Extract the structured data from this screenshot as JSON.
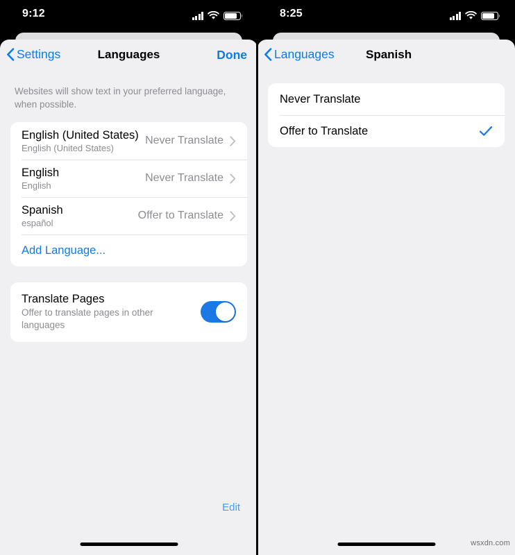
{
  "colors": {
    "accent_blue": "#0a7bf0",
    "toggle_blue": "#1a79e5",
    "check_blue": "#1f7be0",
    "sheet_bg": "#f0f0f3",
    "card_bg": "#ffffff",
    "secondary_text": "#8c8c91",
    "edit_blue": "#4a9bf5"
  },
  "left_panel": {
    "status": {
      "time": "9:12",
      "signal_icon": "cellular-signal-icon",
      "wifi_icon": "wifi-icon",
      "battery_icon": "battery-icon"
    },
    "nav": {
      "back_label": "Settings",
      "back_icon": "chevron-left-icon",
      "title": "Languages",
      "done_label": "Done"
    },
    "footnote": "Websites will show text in your preferred language, when possible.",
    "languages": [
      {
        "title": "English (United States)",
        "subtitle": "English (United States)",
        "value": "Never Translate",
        "disclosure_icon": "chevron-right-icon"
      },
      {
        "title": "English",
        "subtitle": "English",
        "value": "Never Translate",
        "disclosure_icon": "chevron-right-icon"
      },
      {
        "title": "Spanish",
        "subtitle": "español",
        "value": "Offer to Translate",
        "disclosure_icon": "chevron-right-icon"
      }
    ],
    "add_language_label": "Add Language...",
    "translate_pages": {
      "title": "Translate Pages",
      "subtitle": "Offer to translate pages in other languages",
      "toggle_state": "on"
    },
    "edit_label": "Edit"
  },
  "right_panel": {
    "status": {
      "time": "8:25",
      "signal_icon": "cellular-signal-icon",
      "wifi_icon": "wifi-icon",
      "battery_icon": "battery-icon"
    },
    "nav": {
      "back_label": "Languages",
      "back_icon": "chevron-left-icon",
      "title": "Spanish"
    },
    "choices": [
      {
        "label": "Never Translate",
        "selected": false
      },
      {
        "label": "Offer to Translate",
        "selected": true,
        "check_icon": "checkmark-icon"
      }
    ]
  },
  "watermark": "wsxdn.com"
}
